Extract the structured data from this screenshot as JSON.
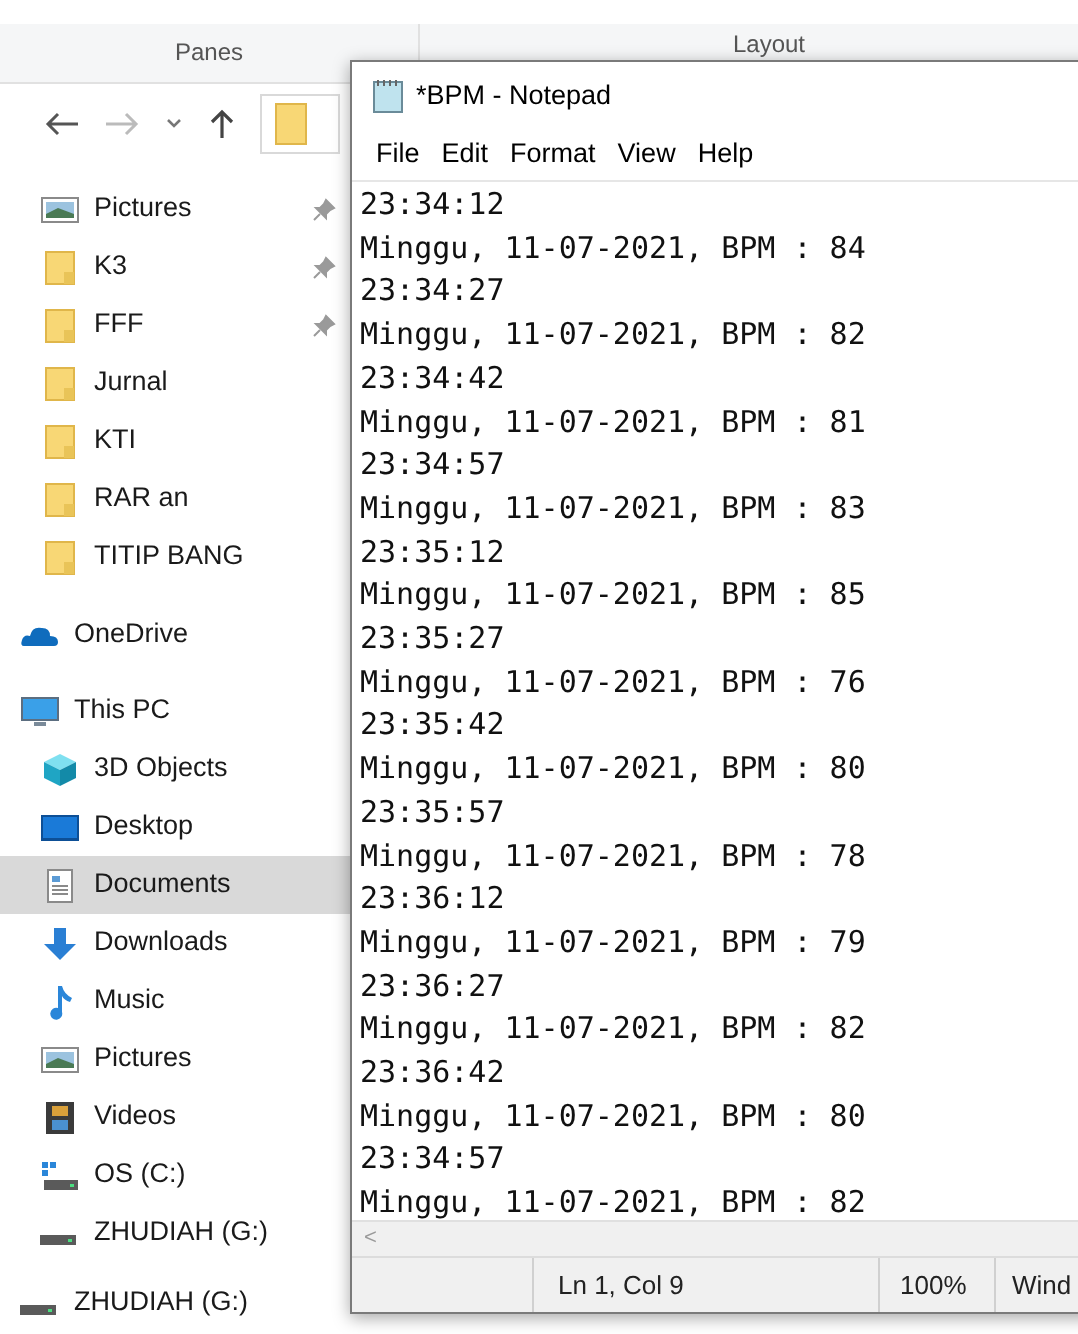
{
  "explorer": {
    "ribbon": {
      "group_1": "Panes",
      "group_2": "Layout"
    },
    "quick_access": [
      {
        "kind": "pictures",
        "label": "Pictures",
        "pinned": true,
        "selected": false
      },
      {
        "kind": "folder",
        "label": "K3",
        "pinned": true,
        "selected": false
      },
      {
        "kind": "folder",
        "label": "FFF",
        "pinned": true,
        "selected": false
      },
      {
        "kind": "folder",
        "label": "Jurnal",
        "pinned": false,
        "selected": false
      },
      {
        "kind": "folder",
        "label": "KTI",
        "pinned": false,
        "selected": false
      },
      {
        "kind": "folder",
        "label": "RAR an",
        "pinned": false,
        "selected": false
      },
      {
        "kind": "folder",
        "label": "TITIP BANG",
        "pinned": false,
        "selected": false
      }
    ],
    "onedrive": {
      "kind": "cloud",
      "label": "OneDrive",
      "selected": false
    },
    "this_pc": {
      "kind": "pc",
      "label": "This PC",
      "selected": false,
      "children": [
        {
          "kind": "cube",
          "label": "3D Objects",
          "selected": false
        },
        {
          "kind": "desktop",
          "label": "Desktop",
          "selected": false
        },
        {
          "kind": "documents",
          "label": "Documents",
          "selected": true
        },
        {
          "kind": "downloads",
          "label": "Downloads",
          "selected": false
        },
        {
          "kind": "music",
          "label": "Music",
          "selected": false
        },
        {
          "kind": "pictures",
          "label": "Pictures",
          "selected": false
        },
        {
          "kind": "videos",
          "label": "Videos",
          "selected": false
        },
        {
          "kind": "windrive",
          "label": "OS (C:)",
          "selected": false
        },
        {
          "kind": "drive",
          "label": "ZHUDIAH (G:)",
          "selected": false
        }
      ]
    },
    "usb_drive": {
      "kind": "drive",
      "label": "ZHUDIAH (G:)",
      "selected": false
    }
  },
  "notepad": {
    "title": "*BPM - Notepad",
    "menu": [
      "File",
      "Edit",
      "Format",
      "View",
      "Help"
    ],
    "lines": [
      "23:34:12",
      "Minggu, 11-07-2021, BPM : 84",
      "23:34:27",
      "Minggu, 11-07-2021, BPM : 82",
      "23:34:42",
      "Minggu, 11-07-2021, BPM : 81",
      "23:34:57",
      "Minggu, 11-07-2021, BPM : 83",
      "23:35:12",
      "Minggu, 11-07-2021, BPM : 85",
      "23:35:27",
      "Minggu, 11-07-2021, BPM : 76",
      "23:35:42",
      "Minggu, 11-07-2021, BPM : 80",
      "23:35:57",
      "Minggu, 11-07-2021, BPM : 78",
      "23:36:12",
      "Minggu, 11-07-2021, BPM : 79",
      "23:36:27",
      "Minggu, 11-07-2021, BPM : 82",
      "23:36:42",
      "Minggu, 11-07-2021, BPM : 80",
      "23:34:57",
      "Minggu, 11-07-2021, BPM : 82"
    ],
    "scroll_left": "<",
    "status": {
      "position": "Ln 1, Col 9",
      "zoom": "100%",
      "line_endings": "Wind"
    }
  }
}
